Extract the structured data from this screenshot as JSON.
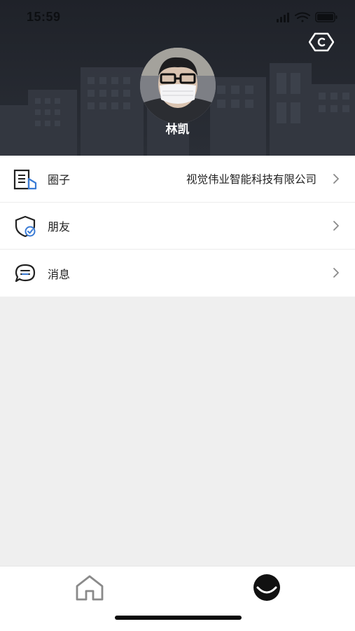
{
  "status_bar": {
    "time": "15:59",
    "icons": [
      "signal-icon",
      "wifi-icon",
      "battery-icon"
    ]
  },
  "header": {
    "username": "林凯",
    "settings_icon": "settings-hex-icon",
    "avatar_icon": "avatar-photo"
  },
  "menu": {
    "items": [
      {
        "label": "圈子",
        "value": "视觉伟业智能科技有限公司",
        "icon": "document-building-icon"
      },
      {
        "label": "朋友",
        "value": "",
        "icon": "shield-check-icon"
      },
      {
        "label": "消息",
        "value": "",
        "icon": "chat-bubble-icon"
      }
    ]
  },
  "tabbar": {
    "tabs": [
      {
        "name": "home",
        "icon": "home-icon",
        "active": false
      },
      {
        "name": "me",
        "icon": "smile-face-icon",
        "active": true
      }
    ]
  },
  "colors": {
    "header_bg": "#23262d",
    "list_bg": "#ffffff",
    "page_bg": "#efefef",
    "accent_blue": "#3a7bd5",
    "text": "#222222",
    "chevron": "#8a8a8a"
  }
}
